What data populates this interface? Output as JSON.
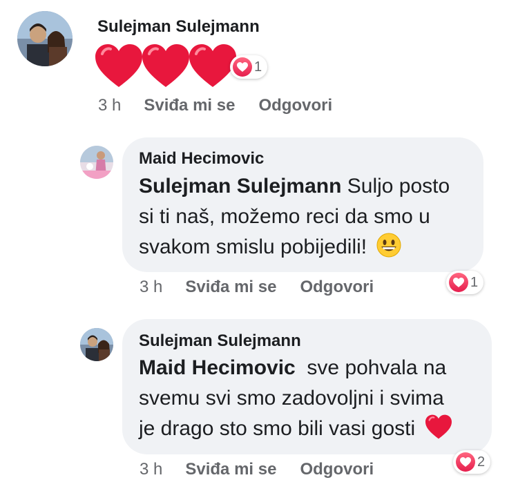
{
  "comments": [
    {
      "author": "Sulejman Sulejmann",
      "reaction_count": "1",
      "time": "3 h",
      "like_label": "Sviđa mi se",
      "reply_label": "Odgovori"
    },
    {
      "author": "Maid Hecimovic",
      "mention": "Sulejman Sulejmann",
      "text_line1": "Suljo posto",
      "text_line2": "si ti naš, možemo reci da smo u",
      "text_line3": "svakom smislu pobijedili!",
      "reaction_count": "1",
      "time": "3 h",
      "like_label": "Sviđa mi se",
      "reply_label": "Odgovori"
    },
    {
      "author": "Sulejman Sulejmann",
      "mention": "Maid Hecimovic",
      "text_line1": "sve pohvala na",
      "text_line2": "svemu svi smo zadovoljni i svima",
      "text_line3": "je drago sto smo bili vasi gosti",
      "reaction_count": "2",
      "time": "3 h",
      "like_label": "Sviđa mi se",
      "reply_label": "Odgovori"
    }
  ],
  "colors": {
    "bubble": "#f0f2f5",
    "meta_text": "#65676b",
    "heart": "#e8173d"
  }
}
